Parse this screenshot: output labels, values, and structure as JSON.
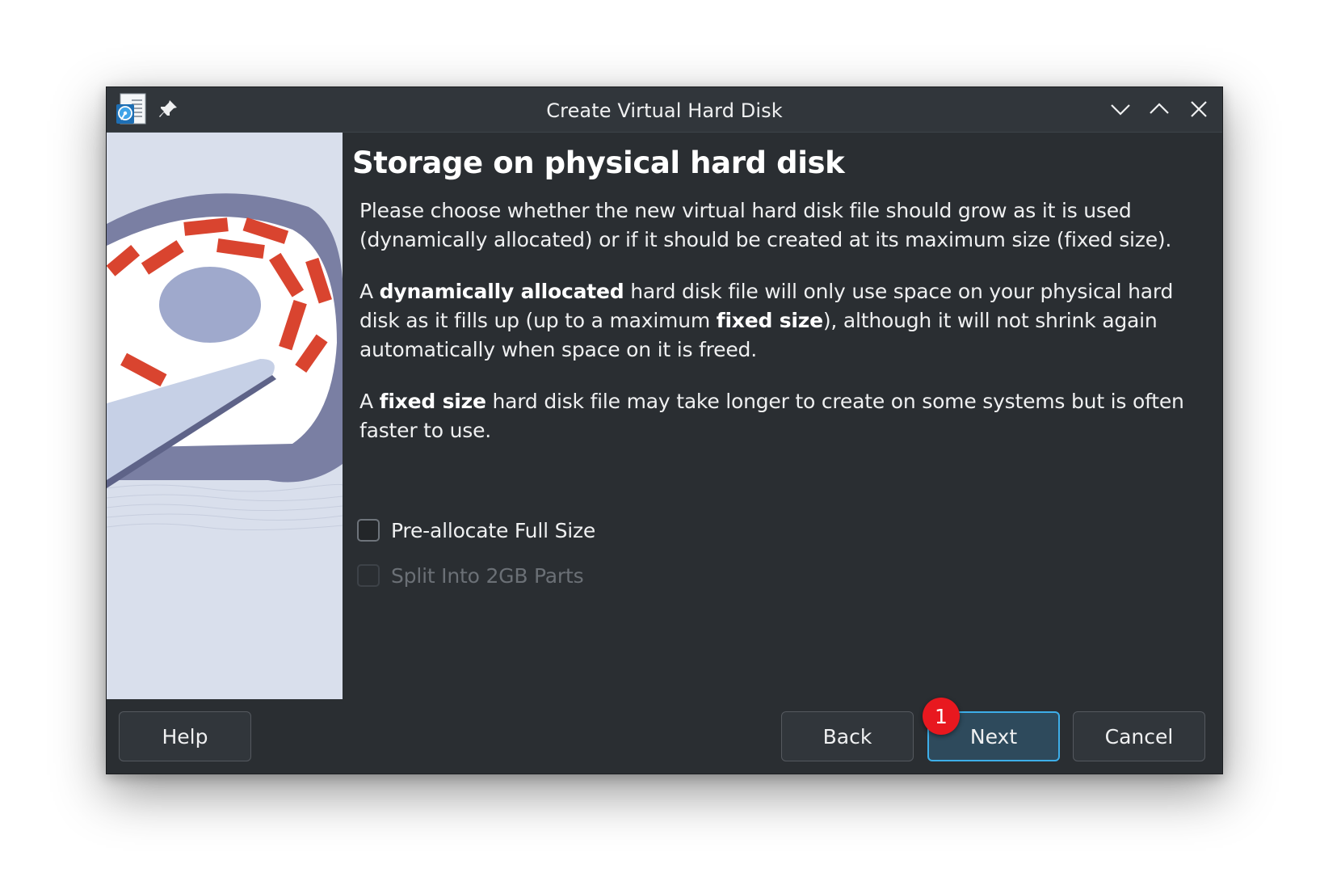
{
  "window": {
    "title": "Create Virtual Hard Disk"
  },
  "icons": {
    "app": "virtualbox-disk-icon",
    "pin": "pin-icon",
    "minimize": "chevron-down-icon",
    "maximize": "chevron-up-icon",
    "close": "close-icon"
  },
  "page": {
    "title": "Storage on physical hard disk",
    "para1": "Please choose whether the new virtual hard disk file should grow as it is used (dynamically allocated) or if it should be created at its maximum size (fixed size).",
    "para2": {
      "a": "A ",
      "b1": "dynamically allocated",
      "c": " hard disk file will only use space on your physical hard disk as it fills up (up to a maximum ",
      "b2": "fixed size",
      "d": "), although it will not shrink again automatically when space on it is freed."
    },
    "para3": {
      "a": "A ",
      "b": "fixed size",
      "c": " hard disk file may take longer to create on some systems but is often faster to use."
    }
  },
  "options": {
    "preallocate": {
      "label": "Pre-allocate Full Size",
      "checked": false,
      "enabled": true
    },
    "split": {
      "label": "Split Into 2GB Parts",
      "checked": false,
      "enabled": false
    }
  },
  "buttons": {
    "help": "Help",
    "back": "Back",
    "next": "Next",
    "cancel": "Cancel"
  },
  "annotation": {
    "badge": "1"
  },
  "colors": {
    "window_bg": "#2a2e32",
    "titlebar_bg": "#31363b",
    "accent": "#3daee9",
    "badge": "#e8181f",
    "banner_bg": "#d9dfec",
    "banner_red": "#d9442f",
    "banner_blue": "#7a7fa3"
  }
}
